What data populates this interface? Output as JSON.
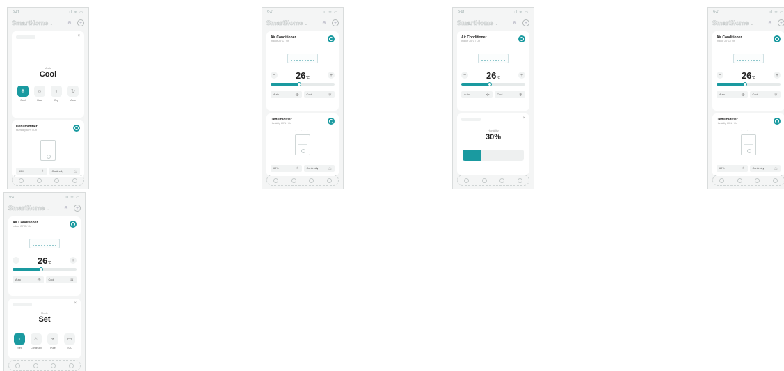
{
  "status": {
    "time": "9:41",
    "signal": "..ıl ᯤ ▭"
  },
  "header": {
    "brand": "SmartHome",
    "chevron": "⌄",
    "notif_icon": "bell-icon",
    "add_icon": "plus-icon",
    "add_glyph": "+",
    "notif_glyph": "⍾"
  },
  "ac": {
    "title": "Air Conditioner",
    "subtitle": "Indoor 20°C / On",
    "temperature": "26",
    "unit": "℃",
    "minus": "−",
    "plus": "+",
    "slider_fraction": 0.45,
    "fan_chip": "Auto",
    "fan_icon": "✣",
    "mode_chip": "Cool",
    "mode_icon": "❄"
  },
  "dehumidifier": {
    "title": "Dehumidifier",
    "subtitle": "Humidity 60% / On",
    "level_chip": "60%",
    "level_icon": "♁",
    "mode_chip": "Continuity",
    "mode_icon": "♨"
  },
  "ac_mode_sheet": {
    "caption": "Mode",
    "value": "Cool",
    "close": "×",
    "options": [
      {
        "label": "Cool",
        "icon": "❄",
        "active": true
      },
      {
        "label": "Heat",
        "icon": "☼",
        "active": false
      },
      {
        "label": "Dry",
        "icon": "♁",
        "active": false
      },
      {
        "label": "Auto",
        "icon": "↻",
        "active": false
      }
    ]
  },
  "humidity_sheet": {
    "caption": "Humidity",
    "value": "30%",
    "close": "×",
    "fraction": 0.3
  },
  "dehum_mode_sheet": {
    "caption": "Mode",
    "value": "Set",
    "close": "×",
    "options": [
      {
        "label": "Set",
        "icon": "♁",
        "active": true
      },
      {
        "label": "Continuity",
        "icon": "♨",
        "active": false
      },
      {
        "label": "Pure",
        "icon": "⌁",
        "active": false
      },
      {
        "label": "ECO",
        "icon": "▭",
        "active": false
      }
    ]
  },
  "colors": {
    "accent": "#1a9aa0",
    "background": "#f4f5f5"
  }
}
